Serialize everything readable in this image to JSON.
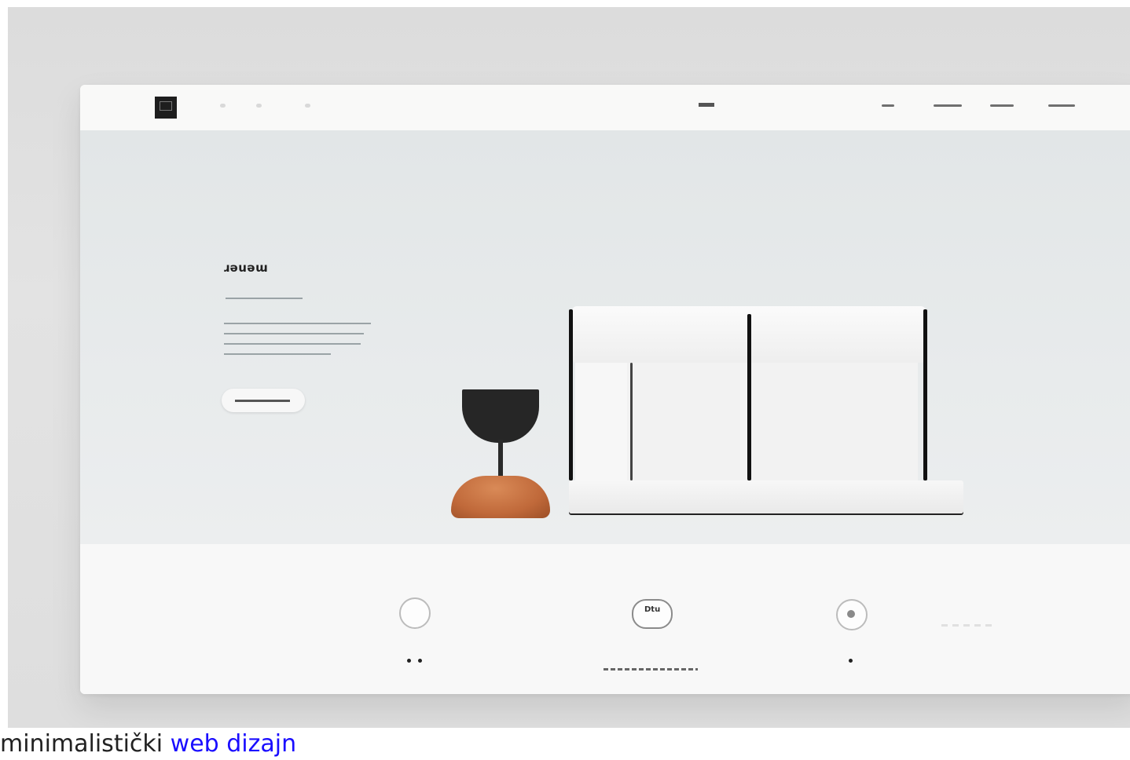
{
  "hero": {
    "title": "ɹǝuǝɯ"
  },
  "features": {
    "badge_label": "Dtu"
  },
  "caption": {
    "text": "minimalistički",
    "link": "web dizajn"
  },
  "colors": {
    "accent_terracotta": "#c0693a",
    "dark": "#262626",
    "link": "#1a0dff"
  }
}
